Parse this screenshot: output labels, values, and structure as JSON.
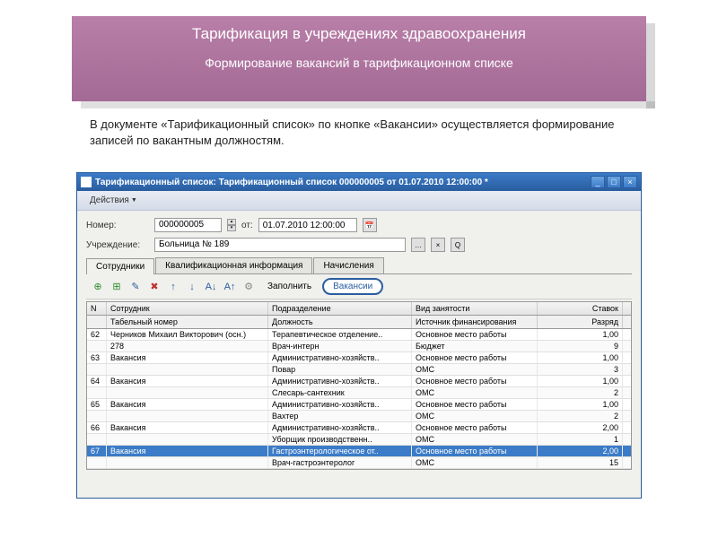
{
  "banner": {
    "title": "Тарификация в учреждениях здравоохранения",
    "subtitle": "Формирование вакансий в тарификационном списке"
  },
  "description": "В документе «Тарификационный список» по кнопке «Вакансии» осуществляется формирование записей по вакантным должностям.",
  "window": {
    "title": "Тарификационный список: Тарификационный список 000000005 от 01.07.2010 12:00:00 *",
    "menu_actions": "Действия",
    "form": {
      "number_label": "Номер:",
      "number": "000000005",
      "date_label": "от:",
      "date": "01.07.2010 12:00:00",
      "institution_label": "Учреждение:",
      "institution": "Больница № 189"
    },
    "tabs": {
      "employees": "Сотрудники",
      "qualification": "Квалификационная информация",
      "accruals": "Начисления"
    },
    "toolbar": {
      "fill": "Заполнить",
      "vacancies": "Вакансии"
    },
    "grid": {
      "headers": {
        "n": "N",
        "employee": "Сотрудник",
        "tab_number": "Табельный номер",
        "department": "Подразделение",
        "position": "Должность",
        "employment": "Вид занятости",
        "source": "Источник финансирования",
        "rate": "Ставок",
        "grade": "Разряд"
      },
      "rows": [
        {
          "n": "62",
          "employee": "Черников Михаил Викторович (осн.)",
          "tab": "278",
          "dept": "Терапевтическое отделение..",
          "pos": "Врач-интерн",
          "empl": "Основное место работы",
          "src": "Бюджет",
          "rate": "1,00",
          "grade": "9"
        },
        {
          "n": "63",
          "employee": "Вакансия",
          "tab": "",
          "dept": "Административно-хозяйств..",
          "pos": "Повар",
          "empl": "Основное место работы",
          "src": "ОМС",
          "rate": "1,00",
          "grade": "3"
        },
        {
          "n": "64",
          "employee": "Вакансия",
          "tab": "",
          "dept": "Административно-хозяйств..",
          "pos": "Слесарь-сантехник",
          "empl": "Основное место работы",
          "src": "ОМС",
          "rate": "1,00",
          "grade": "2"
        },
        {
          "n": "65",
          "employee": "Вакансия",
          "tab": "",
          "dept": "Административно-хозяйств..",
          "pos": "Вахтер",
          "empl": "Основное место работы",
          "src": "ОМС",
          "rate": "1,00",
          "grade": "2"
        },
        {
          "n": "66",
          "employee": "Вакансия",
          "tab": "",
          "dept": "Административно-хозяйств..",
          "pos": "Уборщик производственн..",
          "empl": "Основное место работы",
          "src": "ОМС",
          "rate": "2,00",
          "grade": "1"
        },
        {
          "n": "67",
          "employee": "Вакансия",
          "tab": "",
          "dept": "Гастроэнтерологическое от..",
          "pos": "Врач-гастроэнтеролог",
          "empl": "Основное место работы",
          "src": "ОМС",
          "rate": "2,00",
          "grade": "15"
        }
      ]
    }
  }
}
